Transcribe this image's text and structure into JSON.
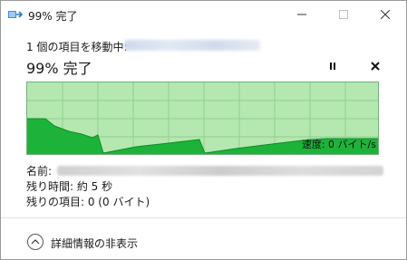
{
  "window": {
    "title": "99% 完了"
  },
  "titlebar": {
    "minimize_icon": "minimize-icon",
    "maximize_icon": "maximize-icon",
    "close_icon": "close-icon"
  },
  "operation": {
    "move_label": "1 個の項目を移動中:",
    "progress_text": "99% 完了",
    "pause_icon": "pause-icon",
    "cancel_icon": "close-icon"
  },
  "graph": {
    "speed_text": "速度: 0 バイト/s",
    "colors": {
      "background": "#b4e8b0",
      "fill": "#1db33a",
      "line": "#0e8a25",
      "grid": "#8fd08a"
    }
  },
  "details": {
    "name_label": "名前:",
    "time_remaining": "残り時間: 約 5 秒",
    "items_remaining": "残りの項目: 0 (0 バイト)"
  },
  "footer": {
    "toggle_label": "詳細情報の非表示",
    "toggle_icon": "chevron-up-icon"
  }
}
